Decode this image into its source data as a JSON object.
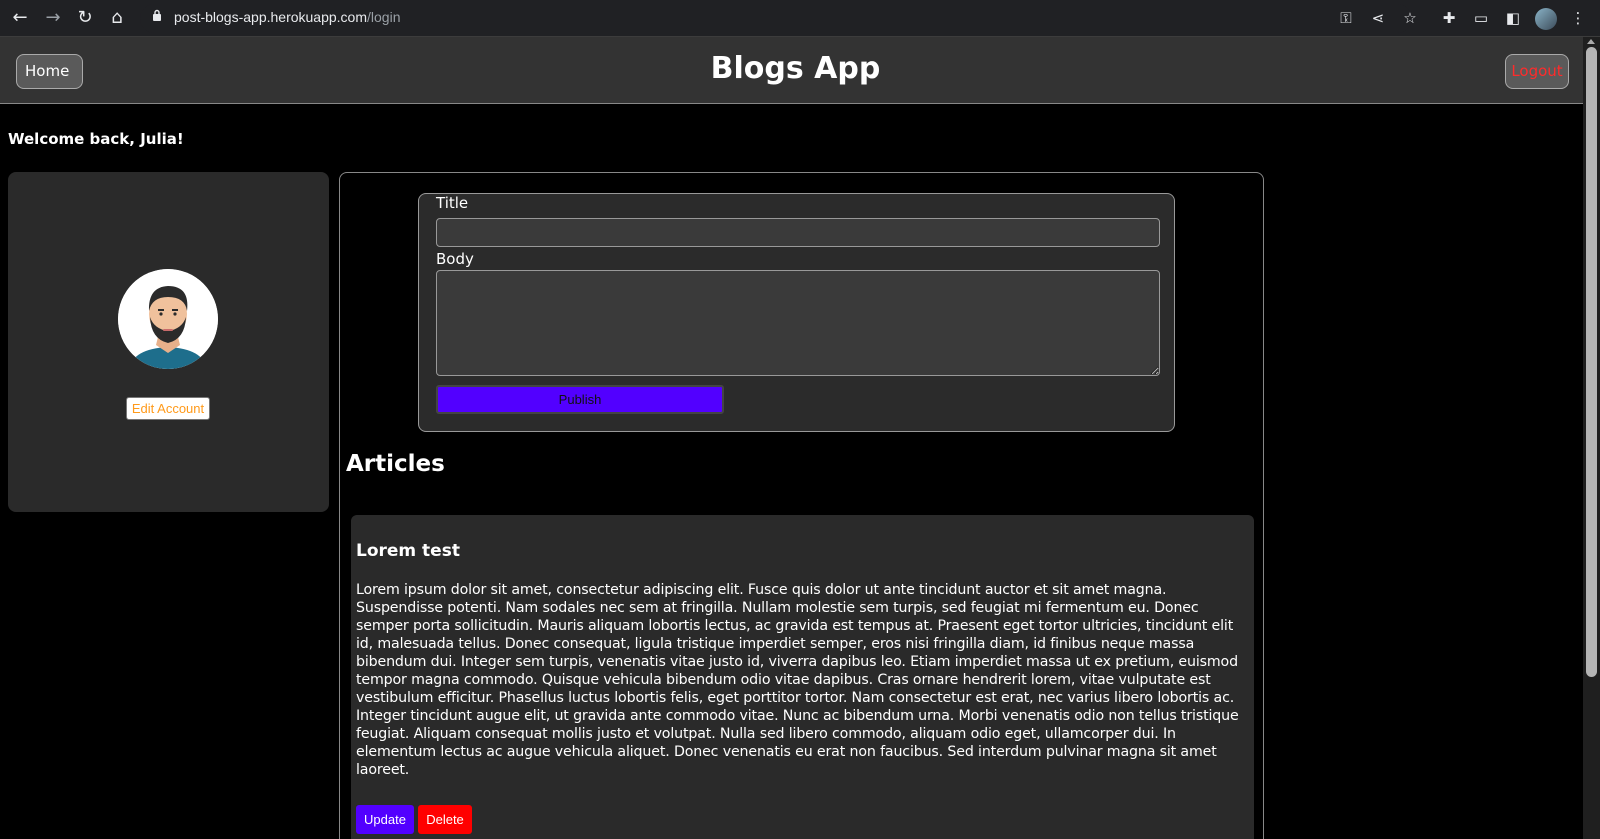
{
  "browser": {
    "url_domain": "post-blogs-app.herokuapp.com",
    "url_path": "/login"
  },
  "header": {
    "home_label": "Home",
    "title": "Blogs App",
    "logout_label": "Logout"
  },
  "welcome": "Welcome back, Julia!",
  "profile": {
    "edit_label": "Edit Account"
  },
  "form": {
    "title_label": "Title",
    "body_label": "Body",
    "title_value": "",
    "body_value": "",
    "publish_label": "Publish"
  },
  "articles": {
    "heading": "Articles",
    "items": [
      {
        "title": "Lorem test",
        "body": "Lorem ipsum dolor sit amet, consectetur adipiscing elit. Fusce quis dolor ut ante tincidunt auctor et sit amet magna. Suspendisse potenti. Nam sodales nec sem at fringilla. Nullam molestie sem turpis, sed feugiat mi fermentum eu. Donec semper porta sollicitudin. Mauris aliquam lobortis lectus, ac gravida est tempus at. Praesent eget tortor ultricies, tincidunt elit id, malesuada tellus. Donec consequat, ligula tristique imperdiet semper, eros nisi fringilla diam, id finibus neque massa bibendum dui. Integer sem turpis, venenatis vitae justo id, viverra dapibus leo. Etiam imperdiet massa ut ex pretium, euismod tempor magna commodo. Quisque vehicula bibendum odio vitae dapibus. Cras ornare hendrerit lorem, vitae vulputate est vestibulum efficitur. Phasellus luctus lobortis felis, eget porttitor tortor. Nam consectetur est erat, nec varius libero lobortis ac. Integer tincidunt augue elit, ut gravida ante commodo vitae. Nunc ac bibendum urna. Morbi venenatis odio non tellus tristique feugiat. Aliquam consequat mollis justo et volutpat. Nulla sed libero commodo, aliquam odio eget, ullamcorper dui. In elementum lectus ac augue vehicula aliquet. Donec venenatis eu erat non faucibus. Sed interdum pulvinar magna sit amet laoreet.",
        "update_label": "Update",
        "delete_label": "Delete"
      }
    ]
  },
  "colors": {
    "accent_purple": "#5200ff",
    "danger_red": "#ff0000",
    "logout_red": "#ff2b2b",
    "edit_orange": "#ff9a1a"
  },
  "icons": [
    "back-arrow-icon",
    "forward-arrow-icon",
    "reload-icon",
    "home-icon",
    "lock-icon",
    "key-icon",
    "share-icon",
    "star-icon",
    "extensions-icon",
    "cast-icon",
    "side-panel-icon",
    "menu-dots-icon"
  ]
}
